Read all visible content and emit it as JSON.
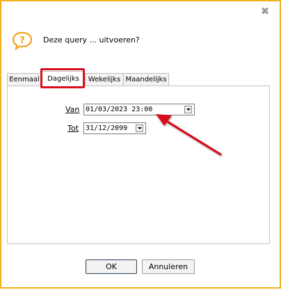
{
  "dialog": {
    "close_glyph": "✖",
    "question": "Deze query ... uitvoeren?",
    "accent_border_color": "#f1b01c",
    "highlight_color": "#d7111f"
  },
  "tabs": [
    {
      "label": "Eenmaal",
      "active": false
    },
    {
      "label": "Dagelijks",
      "active": true
    },
    {
      "label": "Wekelijks",
      "active": false
    },
    {
      "label": "Maandelijks",
      "active": false
    }
  ],
  "form": {
    "from_label": "Van",
    "from_value": "01/03/2023 23:00",
    "to_label": "Tot",
    "to_value": "31/12/2099"
  },
  "buttons": {
    "ok_label": "OK",
    "cancel_label": "Annuleren"
  }
}
